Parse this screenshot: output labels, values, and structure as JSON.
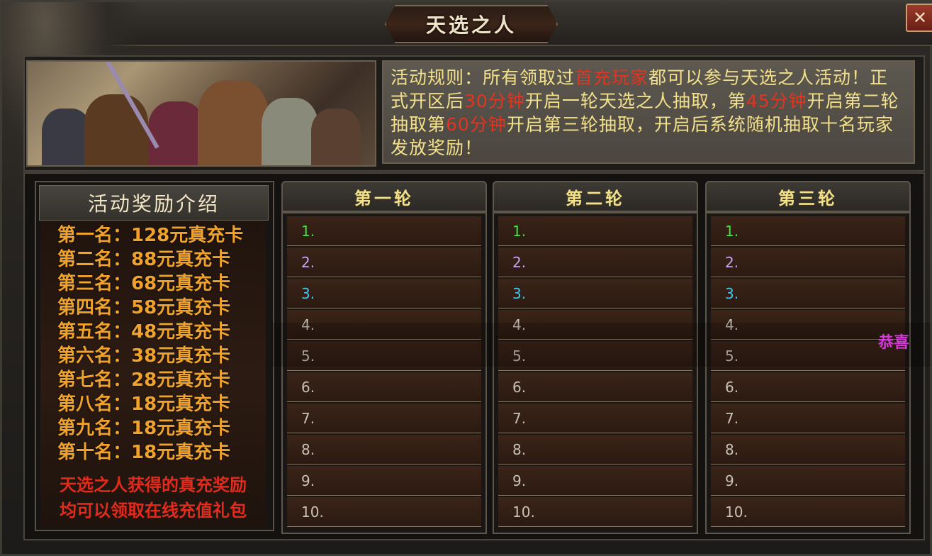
{
  "window": {
    "title": "天选之人",
    "close_label": "✕"
  },
  "rules": {
    "segments": [
      {
        "text": "活动规则：所有领取过",
        "color": "normal"
      },
      {
        "text": "首充玩家",
        "color": "red"
      },
      {
        "text": "都可以参与天选之人活动！正式开区后",
        "color": "normal"
      },
      {
        "text": "30分钟",
        "color": "red"
      },
      {
        "text": "开启一轮天选之人抽取，第",
        "color": "normal"
      },
      {
        "text": "45分钟",
        "color": "red"
      },
      {
        "text": "开启第二轮抽取第",
        "color": "normal"
      },
      {
        "text": "60分钟",
        "color": "red"
      },
      {
        "text": "开启第三轮抽取，开启后系统随机抽取十名玩家发放奖励！",
        "color": "normal"
      }
    ]
  },
  "rewards": {
    "heading": "活动奖励介绍",
    "items": [
      "第一名：128元真充卡",
      "第二名：88元真充卡",
      "第三名：68元真充卡",
      "第四名：58元真充卡",
      "第五名：48元真充卡",
      "第六名：38元真充卡",
      "第七名：28元真充卡",
      "第八名：18元真充卡",
      "第九名：18元真充卡",
      "第十名：18元真充卡"
    ],
    "note_line1": "天选之人获得的真充奖励",
    "note_line2": "均可以领取在线充值礼包"
  },
  "rounds": [
    {
      "title": "第一轮",
      "slots": [
        "1.",
        "2.",
        "3.",
        "4.",
        "5.",
        "6.",
        "7.",
        "8.",
        "9.",
        "10."
      ]
    },
    {
      "title": "第二轮",
      "slots": [
        "1.",
        "2.",
        "3.",
        "4.",
        "5.",
        "6.",
        "7.",
        "8.",
        "9.",
        "10."
      ]
    },
    {
      "title": "第三轮",
      "slots": [
        "1.",
        "2.",
        "3.",
        "4.",
        "5.",
        "6.",
        "7.",
        "8.",
        "9.",
        "10."
      ]
    }
  ],
  "rank_colors": [
    "#3ee83e",
    "#c9a4f0",
    "#3ec8f0",
    "#c8c2b8",
    "#c8c2b8",
    "#c8c2b8",
    "#c8c2b8",
    "#c8c2b8",
    "#c8c2b8",
    "#c8c2b8"
  ],
  "colors": {
    "rule_text": "#f3e08a",
    "highlight": "#e2341f",
    "reward_text": "#f0a22a",
    "note": "#e12b1d"
  },
  "overlay": {
    "congrats": "恭喜"
  }
}
